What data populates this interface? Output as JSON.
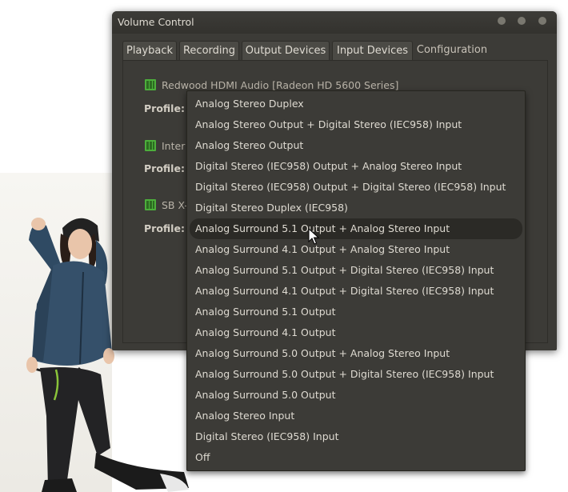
{
  "window": {
    "title": "Volume Control"
  },
  "tabs": [
    {
      "label": "Playback"
    },
    {
      "label": "Recording"
    },
    {
      "label": "Output Devices"
    },
    {
      "label": "Input Devices"
    },
    {
      "label": "Configuration",
      "active": true
    }
  ],
  "cards": [
    {
      "name": "Redwood HDMI Audio [Radeon HD 5600 Series]",
      "profile_label": "Profile:"
    },
    {
      "name": "Inter",
      "profile_label": "Profile:"
    },
    {
      "name": "SB X-",
      "profile_label": "Profile:"
    }
  ],
  "menu": {
    "items": [
      {
        "label": "Analog Stereo Duplex"
      },
      {
        "label": "Analog Stereo Output + Digital Stereo (IEC958) Input"
      },
      {
        "label": "Analog Stereo Output"
      },
      {
        "label": "Digital Stereo (IEC958) Output + Analog Stereo Input"
      },
      {
        "label": "Digital Stereo (IEC958) Output + Digital Stereo (IEC958) Input"
      },
      {
        "label": "Digital Stereo Duplex (IEC958)"
      },
      {
        "label": "Analog Surround 5.1 Output + Analog Stereo Input",
        "hover": true
      },
      {
        "label": "Analog Surround 4.1 Output + Analog Stereo Input"
      },
      {
        "label": "Analog Surround 5.1 Output + Digital Stereo (IEC958) Input"
      },
      {
        "label": "Analog Surround 4.1 Output + Digital Stereo (IEC958) Input"
      },
      {
        "label": "Analog Surround 5.1 Output"
      },
      {
        "label": "Analog Surround 4.1 Output"
      },
      {
        "label": "Analog Surround 5.0 Output + Analog Stereo Input"
      },
      {
        "label": "Analog Surround 5.0 Output + Digital Stereo (IEC958) Input"
      },
      {
        "label": "Analog Surround 5.0 Output"
      },
      {
        "label": "Analog Stereo Input"
      },
      {
        "label": "Digital Stereo (IEC958) Input"
      },
      {
        "label": "Off"
      }
    ]
  },
  "colors": {
    "window_bg": "#3c3b37",
    "text": "#dfdbd2",
    "card_icon": "#4caf3b"
  },
  "icons": {
    "card": "sound-card-icon",
    "pointer": "mouse-pointer-icon"
  }
}
